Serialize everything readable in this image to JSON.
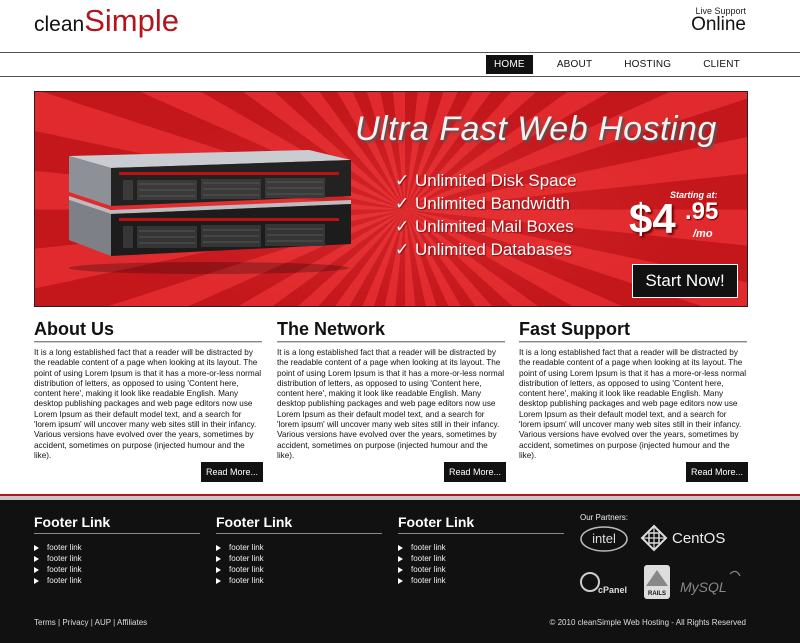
{
  "header": {
    "logo_part1": "clean",
    "logo_part2": "Simple",
    "support_label": "Live Support",
    "support_status": "Online"
  },
  "nav": {
    "items": [
      {
        "label": "HOME",
        "active": true
      },
      {
        "label": "ABOUT",
        "active": false
      },
      {
        "label": "HOSTING",
        "active": false
      },
      {
        "label": "CLIENT",
        "active": false
      }
    ]
  },
  "banner": {
    "title": "Ultra Fast Web Hosting",
    "features": [
      "Unlimited Disk Space",
      "Unlimited Bandwidth",
      "Unlimited Mail Boxes",
      "Unlimited Databases"
    ],
    "price_label": "Starting at:",
    "price_dollars": "$4",
    "price_cents": ".95",
    "price_period": "/mo",
    "cta": "Start Now!"
  },
  "columns": [
    {
      "title": "About Us",
      "body": "It is a long established fact that a reader will be distracted by the readable content of a page when looking at its layout. The point of using Lorem Ipsum is that it has a more-or-less normal distribution of letters, as opposed to using 'Content here, content here', making it look like readable English. Many desktop publishing packages and web page editors now use Lorem Ipsum as their default model text, and a search for 'lorem ipsum' will uncover many web sites still in their infancy. Various versions have evolved over the years, sometimes by accident, sometimes on purpose (injected humour and the like).",
      "button": "Read More..."
    },
    {
      "title": "The Network",
      "body": "It is a long established fact that a reader will be distracted by the readable content of a page when looking at its layout. The point of using Lorem Ipsum is that it has a more-or-less normal distribution of letters, as opposed to using 'Content here, content here', making it look like readable English. Many desktop publishing packages and web page editors now use Lorem Ipsum as their default model text, and a search for 'lorem ipsum' will uncover many web sites still in their infancy. Various versions have evolved over the years, sometimes by accident, sometimes on purpose (injected humour and the like).",
      "button": "Read More..."
    },
    {
      "title": "Fast Support",
      "body": "It is a long established fact that a reader will be distracted by the readable content of a page when looking at its layout. The point of using Lorem Ipsum is that it has a more-or-less normal distribution of letters, as opposed to using 'Content here, content here', making it look like readable English. Many desktop publishing packages and web page editors now use Lorem Ipsum as their default model text, and a search for 'lorem ipsum' will uncover many web sites still in their infancy. Various versions have evolved over the years, sometimes by accident, sometimes on purpose (injected humour and the like).",
      "button": "Read More..."
    }
  ],
  "footer": {
    "columns": [
      {
        "title": "Footer Link",
        "links": [
          "footer link",
          "footer link",
          "footer link",
          "footer link"
        ]
      },
      {
        "title": "Footer Link",
        "links": [
          "footer link",
          "footer link",
          "footer link",
          "footer link"
        ]
      },
      {
        "title": "Footer Link",
        "links": [
          "footer link",
          "footer link",
          "footer link",
          "footer link"
        ]
      }
    ],
    "partners_label": "Our Partners:",
    "partner_logos": [
      "intel",
      "CentOS",
      "cPanel",
      "RAILS",
      "MySQL"
    ],
    "bottom_links": [
      "Terms",
      "Privacy",
      "AUP",
      "Affiliates"
    ],
    "copyright": "© 2010 cleanSimple Web Hosting - All Rights Reserved"
  },
  "colors": {
    "brand_red": "#b3151d",
    "banner_red": "#d9242a",
    "footer_bg": "#111111"
  }
}
